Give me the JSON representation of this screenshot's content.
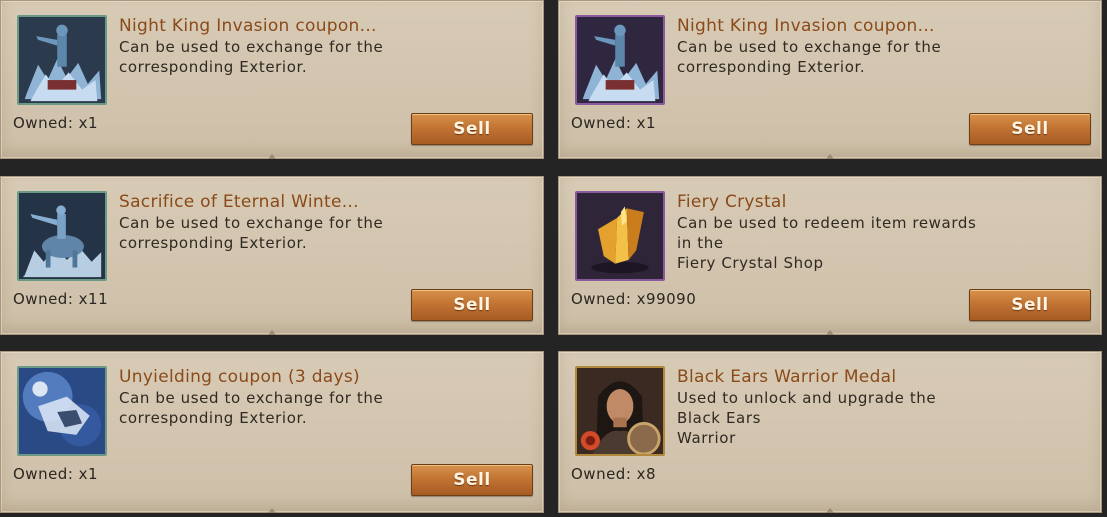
{
  "sell_label": "Sell",
  "colors": {
    "card_bg": "#d6c9b3",
    "title": "#8a4a1a",
    "button": "#c27433",
    "page_bg": "#242424"
  },
  "items": [
    {
      "title": "Night King Invasion coupon...",
      "desc_line1": "Can be used to exchange for the",
      "desc_line2": "corresponding Exterior.",
      "owned": "Owned: x1",
      "icon": "night-king-statue-icon"
    },
    {
      "title": "Night King Invasion coupon...",
      "desc_line1": "Can be used to exchange for the",
      "desc_line2": "corresponding Exterior.",
      "owned": "Owned: x1",
      "icon": "night-king-statue-icon"
    },
    {
      "title": "Sacrifice of Eternal Winte...",
      "desc_line1": "Can be used to exchange for the",
      "desc_line2": "corresponding Exterior.",
      "owned": "Owned: x11",
      "icon": "horse-rider-statue-icon"
    },
    {
      "title": "Fiery Crystal",
      "desc_line1": "Can be used to redeem item rewards in the",
      "desc_line2": "Fiery Crystal Shop",
      "owned": "Owned: x99090",
      "icon": "fiery-crystal-icon"
    },
    {
      "title": "Unyielding coupon (3 days)",
      "desc_line1": "Can be used to exchange for the",
      "desc_line2": "corresponding Exterior.",
      "owned": "Owned: x1",
      "icon": "frost-rider-icon"
    },
    {
      "title": "Black Ears Warrior Medal",
      "desc_line1": "Used to unlock and upgrade the Black Ears",
      "desc_line2": "Warrior",
      "owned": "Owned: x8",
      "icon": "warrior-portrait-icon"
    }
  ]
}
